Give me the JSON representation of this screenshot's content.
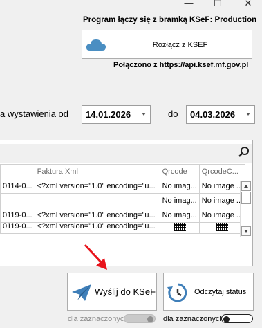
{
  "window": {
    "min_glyph": "—",
    "max_glyph": "☐",
    "close_glyph": "✕"
  },
  "ksef": {
    "connection_info": "Program łączy się z bramką KSeF: Production",
    "disconnect_label": "Rozłącz z KSEF",
    "connected_to": "Połączono z https://api.ksef.mf.gov.pl"
  },
  "filter": {
    "date_label": "a wystawienia od",
    "date_from": "14.01.2026",
    "to_label": "do",
    "date_to": "04.03.2026"
  },
  "grid": {
    "columns": [
      "",
      "Faktura Xml",
      "Qrcode",
      "QrcodeC..."
    ],
    "rows": [
      [
        "0114-0...",
        "<?xml version=\"1.0\" encoding=\"u...",
        "No imag...",
        "No image ..."
      ],
      [
        "",
        "",
        "No imag...",
        "No image ..."
      ],
      [
        "0119-0...",
        "<?xml version=\"1.0\" encoding=\"u...",
        "No imag...",
        "No image ..."
      ],
      [
        "0119-0...",
        "<?xml version=\"1.0\" encoding=\"u...",
        "",
        ""
      ]
    ]
  },
  "actions": {
    "send_label": "Wyślij do KSeF",
    "status_label": "Odczytaj status",
    "send_toggle_label": "dla zaznaczonyc",
    "status_toggle_label": "dla zaznaczonych"
  },
  "colors": {
    "accent": "#4a8ec2",
    "arrow_red": "#e8131b"
  }
}
